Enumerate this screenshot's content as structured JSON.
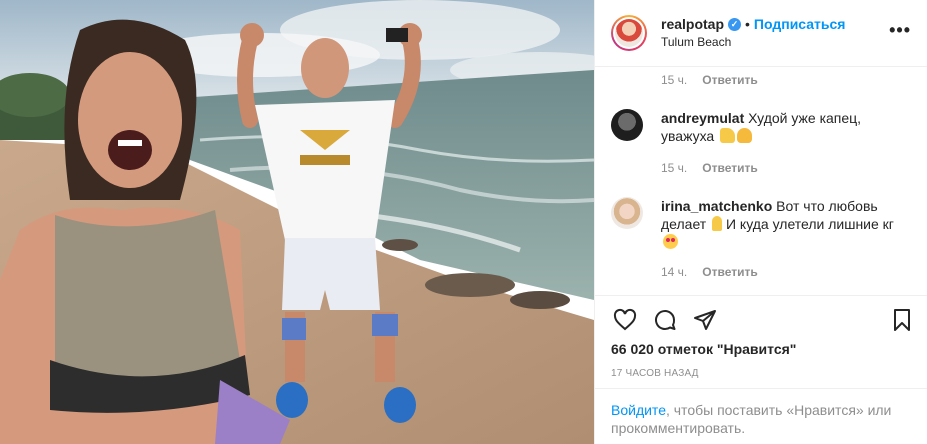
{
  "header": {
    "username": "realpotap",
    "verified_glyph": "✓",
    "dot": "•",
    "follow_label": "Подписаться",
    "location": "Tulum Beach",
    "more_label": "•••"
  },
  "comments": {
    "first_meta": {
      "time": "15 ч.",
      "reply": "Ответить"
    },
    "items": [
      {
        "user": "andreymulat",
        "text": "Худой уже капец, уважуха",
        "time": "15 ч.",
        "reply": "Ответить",
        "emoji": [
          "thumbs-up",
          "clapping-hands"
        ]
      },
      {
        "user": "irina_matchenko",
        "text": "Вот что любовь делает",
        "text2": "И куда улетели лишние кг",
        "time": "14 ч.",
        "reply": "Ответить",
        "emoji": [
          "ok-hand",
          "heart-eyes"
        ]
      }
    ]
  },
  "actions": {
    "icons": [
      "heart-icon",
      "comment-icon",
      "share-icon",
      "bookmark-icon"
    ],
    "likes": "66 020 отметок \"Нравится\"",
    "time_ago": "17 часов назад"
  },
  "footer": {
    "login_label": "Войдите",
    "rest": ", чтобы поставить «Нравится» или прокомментировать."
  },
  "colors": {
    "link": "#0095f6",
    "verified": "#3897f0",
    "muted": "#8e8e8e",
    "text": "#262626"
  }
}
